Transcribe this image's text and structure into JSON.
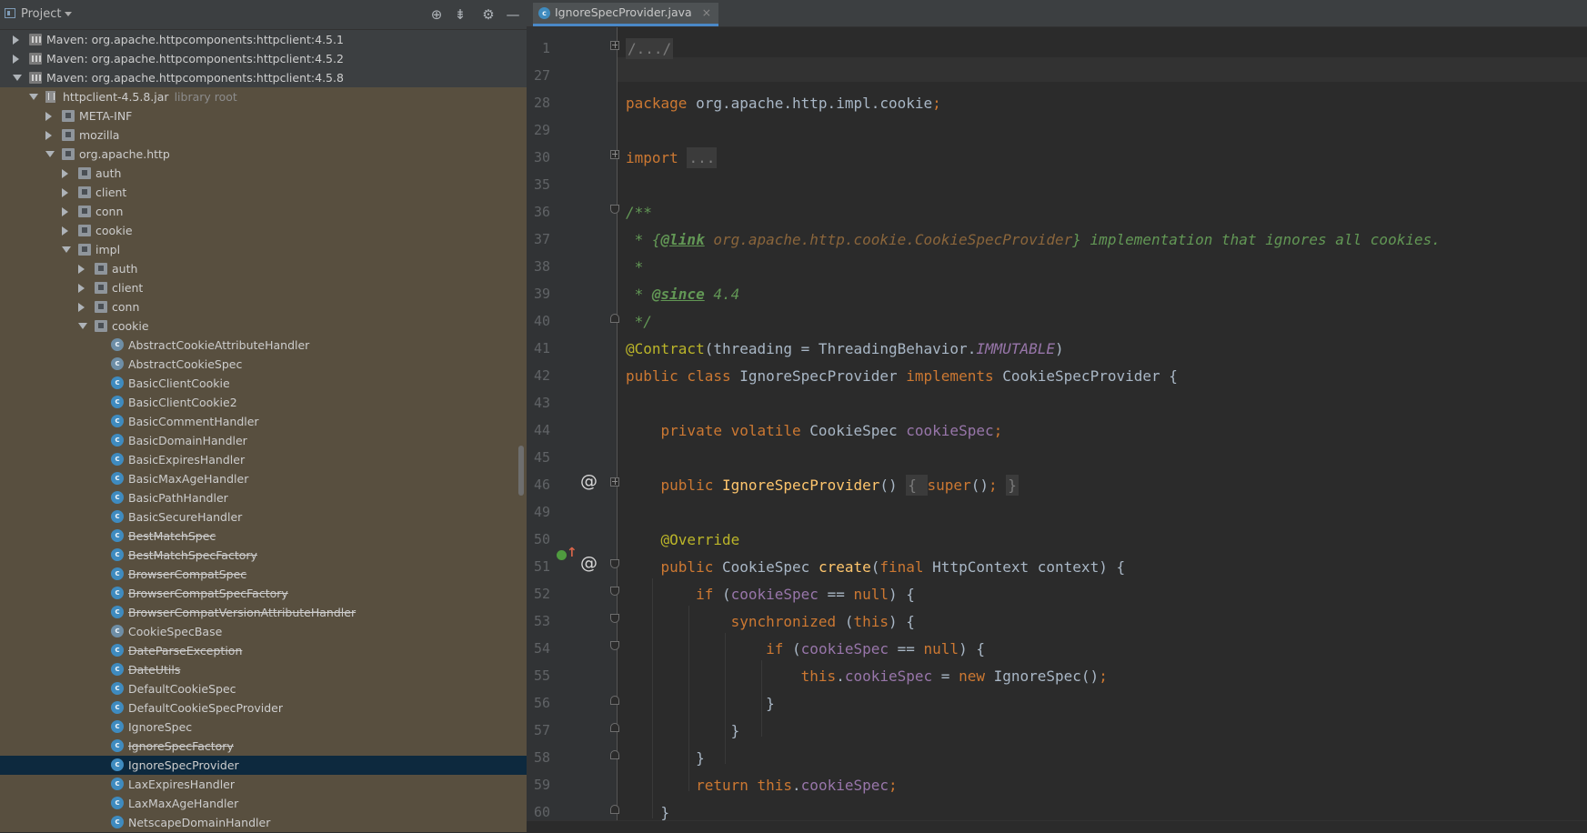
{
  "project": {
    "header_title": "Project",
    "tools": [
      "locate-icon",
      "collapse-icon",
      "gear-icon",
      "minimize-icon"
    ],
    "rows": [
      {
        "label": "Maven: org.apache.httpcomponents:httpclient:4.5.1",
        "icon": "library-icon",
        "arrow": "right"
      },
      {
        "label": "Maven: org.apache.httpcomponents:httpclient:4.5.2",
        "icon": "library-icon",
        "arrow": "right"
      },
      {
        "label": "Maven: org.apache.httpcomponents:httpclient:4.5.8",
        "icon": "library-icon",
        "arrow": "down"
      },
      {
        "label": "httpclient-4.5.8.jar",
        "extra": "library root",
        "icon": "jar-icon",
        "arrow": "down"
      },
      {
        "label": "META-INF",
        "icon": "folder-icon",
        "arrow": "right"
      },
      {
        "label": "mozilla",
        "icon": "package-icon",
        "arrow": "right"
      },
      {
        "label": "org.apache.http",
        "icon": "package-icon",
        "arrow": "down"
      },
      {
        "label": "auth",
        "icon": "package-icon",
        "arrow": "right"
      },
      {
        "label": "client",
        "icon": "package-icon",
        "arrow": "right"
      },
      {
        "label": "conn",
        "icon": "package-icon",
        "arrow": "right"
      },
      {
        "label": "cookie",
        "icon": "package-icon",
        "arrow": "right"
      },
      {
        "label": "impl",
        "icon": "package-icon",
        "arrow": "down"
      },
      {
        "label": "auth",
        "icon": "package-icon",
        "arrow": "right"
      },
      {
        "label": "client",
        "icon": "package-icon",
        "arrow": "right"
      },
      {
        "label": "conn",
        "icon": "package-icon",
        "arrow": "right"
      },
      {
        "label": "cookie",
        "icon": "package-icon",
        "arrow": "down"
      },
      {
        "label": "AbstractCookieAttributeHandler",
        "icon": "abstract-class-icon"
      },
      {
        "label": "AbstractCookieSpec",
        "icon": "abstract-class-icon"
      },
      {
        "label": "BasicClientCookie",
        "icon": "class-icon"
      },
      {
        "label": "BasicClientCookie2",
        "icon": "class-icon"
      },
      {
        "label": "BasicCommentHandler",
        "icon": "class-icon"
      },
      {
        "label": "BasicDomainHandler",
        "icon": "class-icon"
      },
      {
        "label": "BasicExpiresHandler",
        "icon": "class-icon"
      },
      {
        "label": "BasicMaxAgeHandler",
        "icon": "class-icon"
      },
      {
        "label": "BasicPathHandler",
        "icon": "class-icon"
      },
      {
        "label": "BasicSecureHandler",
        "icon": "class-icon"
      },
      {
        "label": "BestMatchSpec",
        "icon": "class-icon",
        "deprecated": true
      },
      {
        "label": "BestMatchSpecFactory",
        "icon": "class-icon",
        "deprecated": true
      },
      {
        "label": "BrowserCompatSpec",
        "icon": "class-icon",
        "deprecated": true
      },
      {
        "label": "BrowserCompatSpecFactory",
        "icon": "class-icon",
        "deprecated": true
      },
      {
        "label": "BrowserCompatVersionAttributeHandler",
        "icon": "class-icon",
        "deprecated": true
      },
      {
        "label": "CookieSpecBase",
        "icon": "abstract-class-icon"
      },
      {
        "label": "DateParseException",
        "icon": "class-icon",
        "deprecated": true
      },
      {
        "label": "DateUtils",
        "icon": "class-icon",
        "deprecated": true
      },
      {
        "label": "DefaultCookieSpec",
        "icon": "class-icon"
      },
      {
        "label": "DefaultCookieSpecProvider",
        "icon": "class-icon"
      },
      {
        "label": "IgnoreSpec",
        "icon": "class-icon"
      },
      {
        "label": "IgnoreSpecFactory",
        "icon": "class-icon",
        "deprecated": true
      },
      {
        "label": "IgnoreSpecProvider",
        "icon": "class-icon",
        "selected": true
      },
      {
        "label": "LaxExpiresHandler",
        "icon": "class-icon"
      },
      {
        "label": "LaxMaxAgeHandler",
        "icon": "class-icon"
      },
      {
        "label": "NetscapeDomainHandler",
        "icon": "class-icon"
      }
    ]
  },
  "editor": {
    "tab_label": "IgnoreSpecProvider.java",
    "tab_icon": "class-icon",
    "lines": [
      {
        "num": "1",
        "parts": [
          [
            "folded",
            "/.../"
          ]
        ]
      },
      {
        "num": "27",
        "parts": []
      },
      {
        "num": "28",
        "parts": [
          [
            "kw",
            "package "
          ],
          [
            "",
            "org.apache.http.impl.cookie"
          ],
          [
            "kw",
            ";"
          ]
        ]
      },
      {
        "num": "29",
        "parts": []
      },
      {
        "num": "30",
        "parts": [
          [
            "kw",
            "import "
          ],
          [
            "folded",
            "..."
          ]
        ]
      },
      {
        "num": "35",
        "parts": []
      },
      {
        "num": "36",
        "parts": [
          [
            "doc",
            "/**"
          ]
        ]
      },
      {
        "num": "37",
        "parts": [
          [
            "doc",
            " * {"
          ],
          [
            "doctag",
            "@link"
          ],
          [
            "doclink",
            " org.apache.http.cookie.CookieSpecProvider"
          ],
          [
            "doc",
            "} implementation that ignores all cookies."
          ]
        ]
      },
      {
        "num": "38",
        "parts": [
          [
            "doc",
            " *"
          ]
        ]
      },
      {
        "num": "39",
        "parts": [
          [
            "doc",
            " * "
          ],
          [
            "doctag",
            "@since"
          ],
          [
            "doc",
            " 4.4"
          ]
        ]
      },
      {
        "num": "40",
        "parts": [
          [
            "doc",
            " */"
          ]
        ]
      },
      {
        "num": "41",
        "parts": [
          [
            "ann",
            "@Contract"
          ],
          [
            "",
            "(threading = ThreadingBehavior."
          ],
          [
            "ital",
            "IMMUTABLE"
          ],
          [
            "",
            ")"
          ]
        ]
      },
      {
        "num": "42",
        "parts": [
          [
            "kw",
            "public class "
          ],
          [
            "",
            "IgnoreSpecProvider "
          ],
          [
            "kw",
            "implements "
          ],
          [
            "",
            "CookieSpecProvider {"
          ]
        ]
      },
      {
        "num": "43",
        "parts": []
      },
      {
        "num": "44",
        "parts": [
          [
            "",
            "    "
          ],
          [
            "kw",
            "private volatile "
          ],
          [
            "",
            "CookieSpec "
          ],
          [
            "fld",
            "cookieSpec"
          ],
          [
            "kw",
            ";"
          ]
        ]
      },
      {
        "num": "45",
        "parts": []
      },
      {
        "num": "46",
        "parts": [
          [
            "",
            "    "
          ],
          [
            "kw",
            "public "
          ],
          [
            "fn",
            "IgnoreSpecProvider"
          ],
          [
            "",
            "() "
          ],
          [
            "folded",
            "{ "
          ],
          [
            "kw",
            "super"
          ],
          [
            "",
            "()"
          ],
          [
            "kw",
            "; "
          ],
          [
            "folded",
            "}"
          ]
        ]
      },
      {
        "num": "49",
        "parts": []
      },
      {
        "num": "50",
        "parts": [
          [
            "",
            "    "
          ],
          [
            "ann",
            "@Override"
          ]
        ]
      },
      {
        "num": "51",
        "parts": [
          [
            "",
            "    "
          ],
          [
            "kw",
            "public "
          ],
          [
            "",
            "CookieSpec "
          ],
          [
            "fn",
            "create"
          ],
          [
            "",
            "("
          ],
          [
            "kw",
            "final "
          ],
          [
            "",
            "HttpContext context) {"
          ]
        ]
      },
      {
        "num": "52",
        "parts": [
          [
            "",
            "        "
          ],
          [
            "kw",
            "if "
          ],
          [
            "",
            "("
          ],
          [
            "fld",
            "cookieSpec"
          ],
          [
            "",
            " == "
          ],
          [
            "kw",
            "null"
          ],
          [
            "",
            ") {"
          ]
        ]
      },
      {
        "num": "53",
        "parts": [
          [
            "",
            "            "
          ],
          [
            "kw",
            "synchronized "
          ],
          [
            "",
            "("
          ],
          [
            "kw",
            "this"
          ],
          [
            "",
            ") {"
          ]
        ]
      },
      {
        "num": "54",
        "parts": [
          [
            "",
            "                "
          ],
          [
            "kw",
            "if "
          ],
          [
            "",
            "("
          ],
          [
            "fld",
            "cookieSpec"
          ],
          [
            "",
            " == "
          ],
          [
            "kw",
            "null"
          ],
          [
            "",
            ") {"
          ]
        ]
      },
      {
        "num": "55",
        "parts": [
          [
            "",
            "                    "
          ],
          [
            "kw",
            "this"
          ],
          [
            "",
            "."
          ],
          [
            "fld",
            "cookieSpec"
          ],
          [
            "",
            " = "
          ],
          [
            "kw",
            "new "
          ],
          [
            "",
            "IgnoreSpec()"
          ],
          [
            "kw",
            ";"
          ]
        ]
      },
      {
        "num": "56",
        "parts": [
          [
            "",
            "                }"
          ]
        ]
      },
      {
        "num": "57",
        "parts": [
          [
            "",
            "            }"
          ]
        ]
      },
      {
        "num": "58",
        "parts": [
          [
            "",
            "        }"
          ]
        ]
      },
      {
        "num": "59",
        "parts": [
          [
            "",
            "        "
          ],
          [
            "kw",
            "return this"
          ],
          [
            "",
            "."
          ],
          [
            "fld",
            "cookieSpec"
          ],
          [
            "kw",
            ";"
          ]
        ]
      },
      {
        "num": "60",
        "parts": [
          [
            "",
            "    }"
          ]
        ]
      }
    ],
    "gutter_markers": {
      "line_46": "at-icon",
      "line_51": [
        "implements-icon",
        "override-up-icon",
        "at-icon"
      ]
    },
    "at_symbol": "@"
  },
  "colors": {
    "keyword": "#cc7832",
    "field": "#9876aa",
    "method": "#ffc66d",
    "annotation": "#bbb529",
    "doc": "#629755",
    "selection": "#0d293e"
  }
}
